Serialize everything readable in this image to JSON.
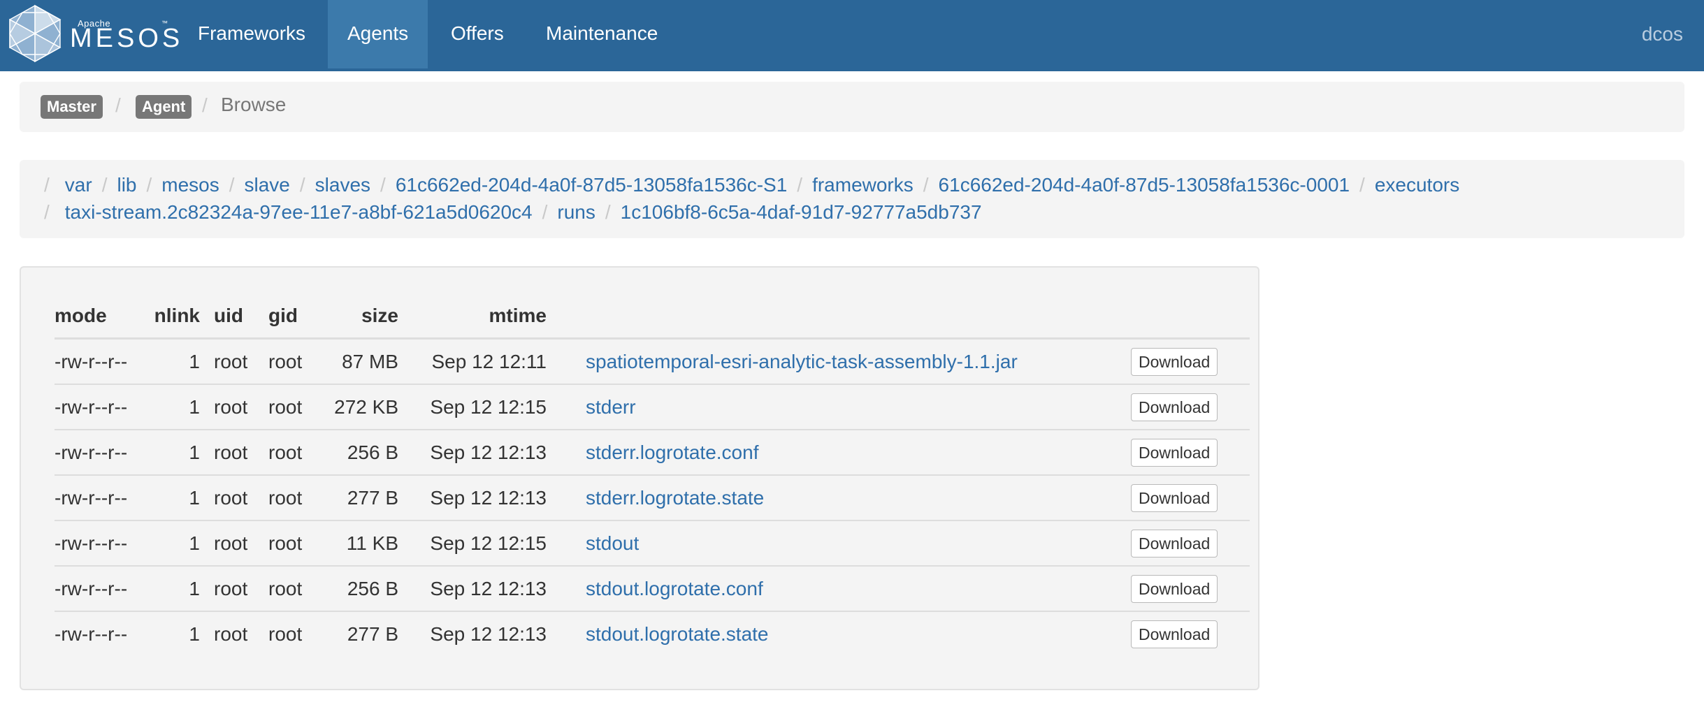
{
  "brand": {
    "top_text": "Apache",
    "name": "MESOS",
    "tm": "™"
  },
  "nav": {
    "items": [
      {
        "label": "Frameworks"
      },
      {
        "label": "Agents"
      },
      {
        "label": "Offers"
      },
      {
        "label": "Maintenance"
      }
    ],
    "active": "Agents",
    "user": "dcos"
  },
  "breadcrumb": {
    "master": "Master",
    "agent": "Agent",
    "current": "Browse"
  },
  "path": {
    "separator": "/",
    "line1": [
      "var",
      "lib",
      "mesos",
      "slave",
      "slaves",
      "61c662ed-204d-4a0f-87d5-13058fa1536c-S1",
      "frameworks",
      "61c662ed-204d-4a0f-87d5-13058fa1536c-0001",
      "executors"
    ],
    "line2": [
      "taxi-stream.2c82324a-97ee-11e7-a8bf-621a5d0620c4",
      "runs",
      "1c106bf8-6c5a-4daf-91d7-92777a5db737"
    ]
  },
  "table": {
    "headers": {
      "mode": "mode",
      "nlink": "nlink",
      "uid": "uid",
      "gid": "gid",
      "size": "size",
      "mtime": "mtime"
    },
    "download_label": "Download",
    "rows": [
      {
        "mode": "-rw-r--r--",
        "nlink": "1",
        "uid": "root",
        "gid": "root",
        "size": "87 MB",
        "mtime": "Sep 12 12:11",
        "name": "spatiotemporal-esri-analytic-task-assembly-1.1.jar"
      },
      {
        "mode": "-rw-r--r--",
        "nlink": "1",
        "uid": "root",
        "gid": "root",
        "size": "272 KB",
        "mtime": "Sep 12 12:15",
        "name": "stderr"
      },
      {
        "mode": "-rw-r--r--",
        "nlink": "1",
        "uid": "root",
        "gid": "root",
        "size": "256 B",
        "mtime": "Sep 12 12:13",
        "name": "stderr.logrotate.conf"
      },
      {
        "mode": "-rw-r--r--",
        "nlink": "1",
        "uid": "root",
        "gid": "root",
        "size": "277 B",
        "mtime": "Sep 12 12:13",
        "name": "stderr.logrotate.state"
      },
      {
        "mode": "-rw-r--r--",
        "nlink": "1",
        "uid": "root",
        "gid": "root",
        "size": "11 KB",
        "mtime": "Sep 12 12:15",
        "name": "stdout"
      },
      {
        "mode": "-rw-r--r--",
        "nlink": "1",
        "uid": "root",
        "gid": "root",
        "size": "256 B",
        "mtime": "Sep 12 12:13",
        "name": "stdout.logrotate.conf"
      },
      {
        "mode": "-rw-r--r--",
        "nlink": "1",
        "uid": "root",
        "gid": "root",
        "size": "277 B",
        "mtime": "Sep 12 12:13",
        "name": "stdout.logrotate.state"
      }
    ]
  },
  "colors": {
    "navbar": "#2b6698",
    "nav_active": "#3c7aab",
    "link": "#2f6fab",
    "panel": "#f4f4f4",
    "chip": "#777777"
  }
}
